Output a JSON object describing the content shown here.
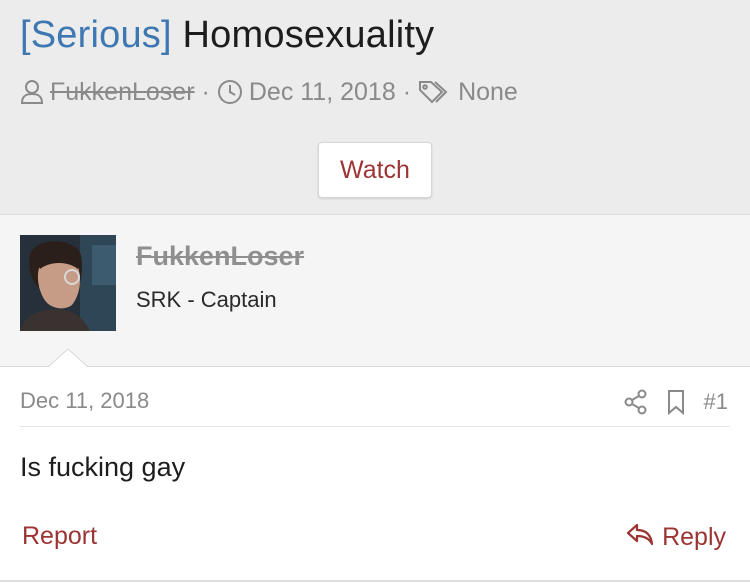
{
  "thread": {
    "prefix": "[Serious]",
    "title": "Homosexuality",
    "author": "FukkenLoser",
    "date": "Dec 11, 2018",
    "tags": "None",
    "separator": "·",
    "watch_label": "Watch"
  },
  "post": {
    "username": "FukkenLoser",
    "user_title": "SRK - Captain",
    "date": "Dec 11, 2018",
    "post_number": "#1",
    "content": "Is fucking gay",
    "report_label": "Report",
    "reply_label": "Reply"
  },
  "colors": {
    "link_blue": "#3e78b3",
    "action_red": "#9c3434",
    "muted_gray": "#8a8a8a",
    "header_bg": "#ececec",
    "userband_bg": "#f5f5f5"
  }
}
